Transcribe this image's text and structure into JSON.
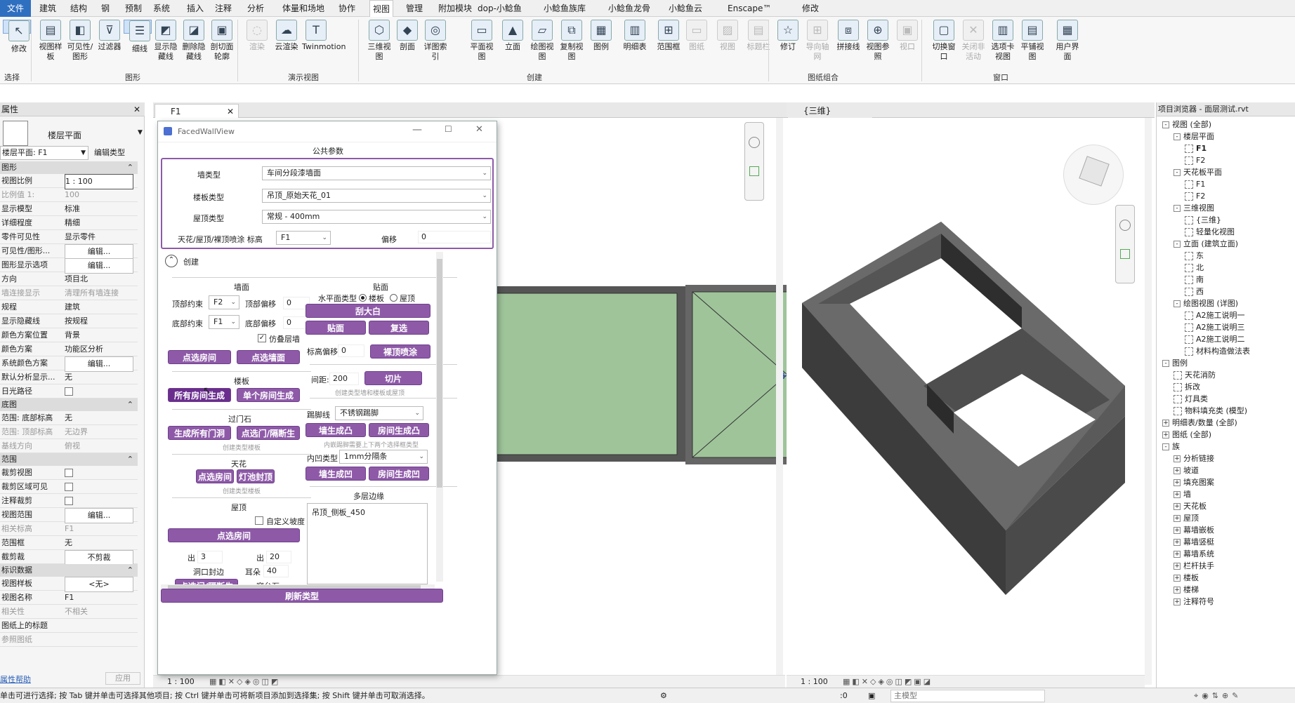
{
  "menu": {
    "items": [
      "文件",
      "建筑",
      "结构",
      "钢",
      "预制",
      "系统",
      "插入",
      "注释",
      "分析",
      "体量和场地",
      "协作",
      "视图",
      "管理",
      "附加模块",
      "dop-小鲶鱼",
      "小鲶鱼族库",
      "小鲶鱼龙骨",
      "小鲶鱼云",
      "Enscape™",
      "修改"
    ],
    "active": "视图"
  },
  "ribbon": {
    "buttons": [
      "修改",
      "视图样板",
      "可见性/图形",
      "过滤器",
      "细线",
      "显示隐藏线",
      "删除隐藏线",
      "剖切面轮廓",
      "渲染",
      "云渲染",
      "Twinmotion",
      "三维视图",
      "剖面",
      "详图索引",
      "平面视图",
      "立面",
      "绘图视图",
      "复制视图",
      "图例",
      "明细表",
      "范围框",
      "图纸",
      "视图",
      "标题栏",
      "修订",
      "导向轴网",
      "拼接线",
      "视图参照",
      "视口",
      "切换窗口",
      "关闭非活动",
      "选项卡视图",
      "平铺视图",
      "用户界面"
    ],
    "groups": [
      "选择",
      "图形",
      "演示视图",
      "创建",
      "图纸组合",
      "窗口"
    ]
  },
  "properties": {
    "title": "属性",
    "type_name": "楼层平面",
    "selector": "楼层平面: F1",
    "edit_type": "编辑类型",
    "sections": {
      "graphics": "图形",
      "underlay": "底图",
      "extents": "范围",
      "identity": "标识数据"
    },
    "rows_graphics": [
      {
        "k": "视图比例",
        "v": "1 : 100"
      },
      {
        "k": "比例值 1:",
        "v": "100"
      },
      {
        "k": "显示模型",
        "v": "标准"
      },
      {
        "k": "详细程度",
        "v": "精细"
      },
      {
        "k": "零件可见性",
        "v": "显示零件"
      },
      {
        "k": "可见性/图形...",
        "v": "编辑..."
      },
      {
        "k": "图形显示选项",
        "v": "编辑..."
      },
      {
        "k": "方向",
        "v": "项目北"
      },
      {
        "k": "墙连接显示",
        "v": "清理所有墙连接"
      },
      {
        "k": "规程",
        "v": "建筑"
      },
      {
        "k": "显示隐藏线",
        "v": "按规程"
      },
      {
        "k": "颜色方案位置",
        "v": "背景"
      },
      {
        "k": "颜色方案",
        "v": "功能区分析"
      },
      {
        "k": "系统颜色方案",
        "v": "编辑..."
      },
      {
        "k": "默认分析显示...",
        "v": "无"
      },
      {
        "k": "日光路径",
        "v": ""
      }
    ],
    "rows_underlay": [
      {
        "k": "范围: 底部标高",
        "v": "无"
      },
      {
        "k": "范围: 顶部标高",
        "v": "无边界"
      },
      {
        "k": "基线方向",
        "v": "俯视"
      }
    ],
    "rows_extents": [
      {
        "k": "裁剪视图",
        "v": ""
      },
      {
        "k": "裁剪区域可见",
        "v": ""
      },
      {
        "k": "注释裁剪",
        "v": ""
      },
      {
        "k": "视图范围",
        "v": "编辑..."
      },
      {
        "k": "相关标高",
        "v": "F1"
      },
      {
        "k": "范围框",
        "v": "无"
      },
      {
        "k": "截剪裁",
        "v": "不剪裁"
      }
    ],
    "rows_identity": [
      {
        "k": "视图样板",
        "v": "<无>"
      },
      {
        "k": "视图名称",
        "v": "F1"
      },
      {
        "k": "相关性",
        "v": "不相关"
      },
      {
        "k": "图纸上的标题",
        "v": ""
      },
      {
        "k": "参照图纸",
        "v": ""
      }
    ],
    "help": "属性帮助",
    "apply": "应用"
  },
  "tabs": {
    "plan": "F1",
    "threeD": "{三维}"
  },
  "dialog": {
    "title": "FacedWallView",
    "public_params": "公共参数",
    "wall_type_label": "墙类型",
    "wall_type": "车间分段漆墙面",
    "floor_type_label": "楼板类型",
    "floor_type": "吊顶_原始天花_01",
    "roof_type_label": "屋顶类型",
    "roof_type": "常规 - 400mm",
    "ceil_label": "天花/屋顶/裸顶喷涂 标高",
    "ceil_level": "F1",
    "offset_label": "偏移",
    "offset_value": "0",
    "create": "创建",
    "wall_section": "墙面",
    "top_constraint": "顶部约束",
    "top_level": "F2",
    "top_offset_label": "顶部偏移",
    "top_offset": "0",
    "bottom_constraint": "底部约束",
    "bottom_level": "F1",
    "bottom_offset_label": "底部偏移",
    "bottom_offset": "0",
    "fake_layer": "仿叠层墙",
    "btn_pick_room": "点选房间",
    "btn_pick_wall": "点选墙面",
    "floor_section": "楼板",
    "btn_all_rooms": "所有房间生成",
    "btn_single_room": "单个房间生成",
    "threshold_section": "过门石",
    "btn_all_doors": "生成所有门洞",
    "btn_pick_door": "点选门/隔断生成",
    "threshold_hint": "创建类型楼板",
    "ceiling_section": "天花",
    "btn_ceil_pick_room": "点选房间",
    "btn_light_trough": "灯池封顶",
    "ceiling_hint": "创建类型楼板",
    "roof_section": "屋顶",
    "custom_slope": "自定义坡度",
    "btn_roof_pick_room": "点选房间",
    "out_label1": "出",
    "out_val1": "3",
    "out_label2": "出",
    "out_val2": "20",
    "opening_edge": "洞口封边",
    "ear_label": "耳朵",
    "ear_val": "40",
    "btn_pick_door2": "点选门/隔断生成",
    "window_sill": "窗台石",
    "tile_section": "贴面",
    "h_plane_type": "水平面类型",
    "radio_floor": "楼板",
    "radio_roof": "屋顶",
    "btn_putty": "刮大白",
    "btn_tile": "贴面",
    "btn_reselect": "复选",
    "level_offset_label": "标高偏移",
    "level_offset": "0",
    "btn_bare_spray": "裸顶喷涂",
    "spacing_label": "间距:",
    "spacing": "200",
    "btn_slice": "切片",
    "slice_hint": "创建类型墙和楼板或屋顶",
    "baseboard_label": "踢脚线",
    "baseboard_type": "不锈钢踢脚",
    "btn_wall_convex": "墙生成凸",
    "btn_room_convex": "房间生成凸",
    "convex_hint": "内嵌踢脚需要上下两个选择框类型",
    "inner_type_label": "内凹类型",
    "inner_type": "1mm分隔条",
    "btn_wall_concave": "墙生成凹",
    "btn_room_concave": "房间生成凹",
    "multi_edge": "多层边缘",
    "multi_list_item": "吊顶_侧板_450",
    "btn_refresh": "刷新类型"
  },
  "plan_statusbar": {
    "scale": "1 : 100"
  },
  "threeD_statusbar": {
    "scale": "1 : 100"
  },
  "browser": {
    "title": "项目浏览器 - 面层测试.rvt",
    "items": [
      {
        "t": "视图 (全部)",
        "d": 0,
        "g": "-"
      },
      {
        "t": "楼层平面",
        "d": 1,
        "g": "-"
      },
      {
        "t": "F1",
        "d": 2,
        "v": 1,
        "bold": 1
      },
      {
        "t": "F2",
        "d": 2,
        "v": 1
      },
      {
        "t": "天花板平面",
        "d": 1,
        "g": "-"
      },
      {
        "t": "F1",
        "d": 2,
        "v": 1
      },
      {
        "t": "F2",
        "d": 2,
        "v": 1
      },
      {
        "t": "三维视图",
        "d": 1,
        "g": "-"
      },
      {
        "t": "{三维}",
        "d": 2,
        "v": 1
      },
      {
        "t": "轻量化视图",
        "d": 2,
        "v": 1
      },
      {
        "t": "立面 (建筑立面)",
        "d": 1,
        "g": "-"
      },
      {
        "t": "东",
        "d": 2,
        "v": 1
      },
      {
        "t": "北",
        "d": 2,
        "v": 1
      },
      {
        "t": "南",
        "d": 2,
        "v": 1
      },
      {
        "t": "西",
        "d": 2,
        "v": 1
      },
      {
        "t": "绘图视图 (详图)",
        "d": 1,
        "g": "-"
      },
      {
        "t": "A2施工说明一",
        "d": 2,
        "v": 1
      },
      {
        "t": "A2施工说明三",
        "d": 2,
        "v": 1
      },
      {
        "t": "A2施工说明二",
        "d": 2,
        "v": 1
      },
      {
        "t": "材料构造做法表",
        "d": 2,
        "v": 1
      },
      {
        "t": "图例",
        "d": 0,
        "g": "-"
      },
      {
        "t": "天花消防",
        "d": 1,
        "v": 1
      },
      {
        "t": "拆改",
        "d": 1,
        "v": 1
      },
      {
        "t": "灯具类",
        "d": 1,
        "v": 1
      },
      {
        "t": "物料填充类 (模型)",
        "d": 1,
        "v": 1
      },
      {
        "t": "明细表/数量 (全部)",
        "d": 0,
        "g": "+"
      },
      {
        "t": "图纸 (全部)",
        "d": 0,
        "g": "+"
      },
      {
        "t": "族",
        "d": 0,
        "g": "-"
      },
      {
        "t": "分析链接",
        "d": 1,
        "g": "+"
      },
      {
        "t": "坡道",
        "d": 1,
        "g": "+"
      },
      {
        "t": "填充图案",
        "d": 1,
        "g": "+"
      },
      {
        "t": "墙",
        "d": 1,
        "g": "+"
      },
      {
        "t": "天花板",
        "d": 1,
        "g": "+"
      },
      {
        "t": "屋顶",
        "d": 1,
        "g": "+"
      },
      {
        "t": "幕墙嵌板",
        "d": 1,
        "g": "+"
      },
      {
        "t": "幕墙竖梃",
        "d": 1,
        "g": "+"
      },
      {
        "t": "幕墙系统",
        "d": 1,
        "g": "+"
      },
      {
        "t": "栏杆扶手",
        "d": 1,
        "g": "+"
      },
      {
        "t": "楼板",
        "d": 1,
        "g": "+"
      },
      {
        "t": "楼梯",
        "d": 1,
        "g": "+"
      },
      {
        "t": "注释符号",
        "d": 1,
        "g": "+"
      }
    ]
  },
  "status": {
    "message": "单击可进行选择; 按 Tab 键并单击可选择其他项目; 按 Ctrl 键并单击可将新项目添加到选择集; 按 Shift 键并单击可取消选择。",
    "zero": ":0",
    "model": "主模型"
  },
  "colors": {
    "accent": "#8e5aa8",
    "room_fill": "#9fc49a",
    "wall_dark": "#444444"
  }
}
